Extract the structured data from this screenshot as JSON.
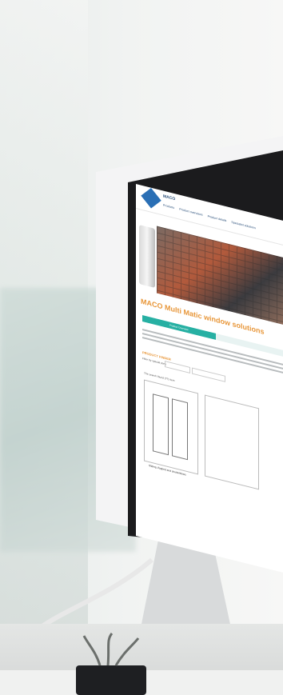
{
  "website": {
    "brand": "MACO",
    "nav_items": [
      "Products",
      "Product overviews",
      "Product details",
      "Specialist solutions"
    ],
    "page_title": "MACO Multi Matic window solutions",
    "active_tab": "Product Overview",
    "product_finder_label": "PRODUCT FINDER",
    "filter_label": "Filter by special parts",
    "filter_placeholder": "Size",
    "result_label": "The search found (??) Item",
    "drawing_caption": "Sliding, flapped and shutterblows"
  },
  "colors": {
    "accent_orange": "#e8973a",
    "accent_teal": "#27b0a3",
    "logo_blue": "#2a6fb5"
  }
}
